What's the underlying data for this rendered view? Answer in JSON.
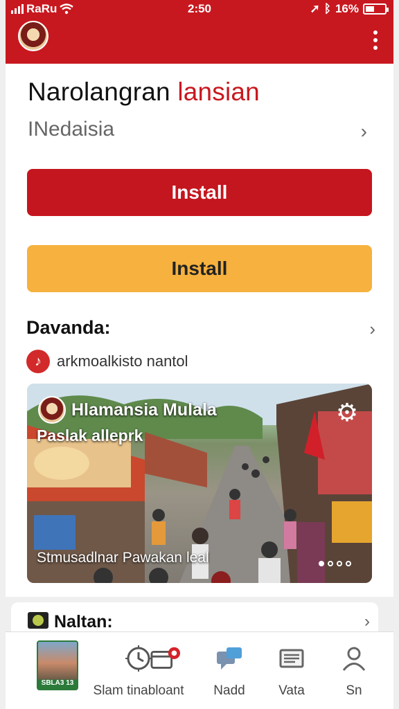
{
  "status_bar": {
    "carrier": "RaRu",
    "time": "2:50",
    "battery": "16%"
  },
  "header": {
    "title_main": "Narolangran",
    "title_accent": "lansian",
    "subtitle": "INedaisia"
  },
  "buttons": {
    "primary_label": "Install",
    "secondary_label": "Install"
  },
  "section": {
    "title": "Davanda:",
    "info_text": "arkmoalkisto nantol"
  },
  "banner": {
    "title": "Hlamansia Mulala",
    "subtitle": "Paslak alleprk",
    "caption": "Stmusadlnar Pawakan  leal",
    "page_count": 4,
    "active_page": 1
  },
  "card2": {
    "title": "Naltan:"
  },
  "bottom_nav": {
    "items": [
      {
        "label": "",
        "thumb_text": "SBLA3 13",
        "icon": "thumbnail"
      },
      {
        "label": "Slam tinabloant",
        "icon": "timer-icon"
      },
      {
        "label": "",
        "icon": "calendar-badge-icon"
      },
      {
        "label": "Nadd",
        "icon": "chat-icon"
      },
      {
        "label": "Vata",
        "icon": "document-icon"
      },
      {
        "label": "Sn",
        "icon": "person-icon"
      }
    ]
  },
  "colors": {
    "brand_red": "#c8181f",
    "accent_yellow": "#f6b13e"
  }
}
